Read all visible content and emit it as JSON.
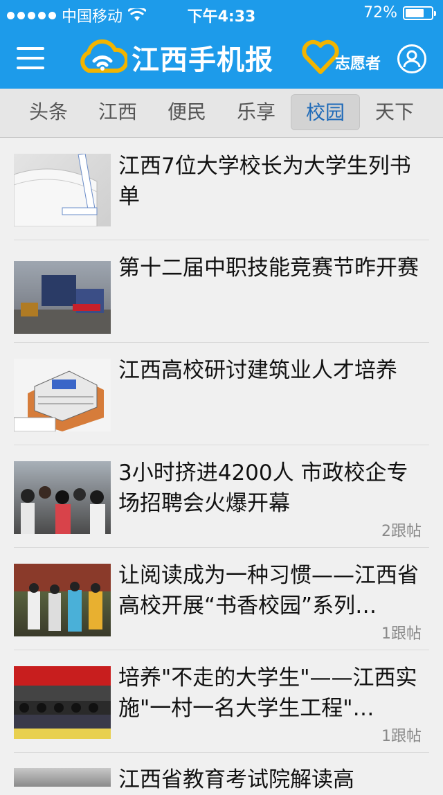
{
  "status_bar": {
    "carrier": "中国移动",
    "time": "下午4:33",
    "battery_text": "72%",
    "battery_level": 0.72
  },
  "header": {
    "app_title": "江西手机报",
    "volunteer_label": "志愿者",
    "menu_icon": "hamburger-menu-icon",
    "user_icon": "user-icon",
    "bar_color": "#1d9bea"
  },
  "tabs": [
    {
      "label": "头条",
      "active": false
    },
    {
      "label": "江西",
      "active": false
    },
    {
      "label": "便民",
      "active": false
    },
    {
      "label": "乐享",
      "active": false
    },
    {
      "label": "校园",
      "active": true
    },
    {
      "label": "天下",
      "active": false
    }
  ],
  "articles": [
    {
      "title": "江西7位大学校长为大学生列书单",
      "replies": ""
    },
    {
      "title": "第十二届中职技能竞赛节昨开赛",
      "replies": ""
    },
    {
      "title": "江西高校研讨建筑业人才培养",
      "replies": ""
    },
    {
      "title": "3小时挤进4200人 市政校企专场招聘会火爆开幕",
      "replies": "2跟帖"
    },
    {
      "title": "让阅读成为一种习惯——江西省高校开展“书香校园”系列…",
      "replies": "1跟帖"
    },
    {
      "title": "培养\"不走的大学生\"——江西实施\"一村一名大学生工程\"…",
      "replies": "1跟帖"
    },
    {
      "title": "江西省教育考试院解读高",
      "replies": ""
    }
  ]
}
